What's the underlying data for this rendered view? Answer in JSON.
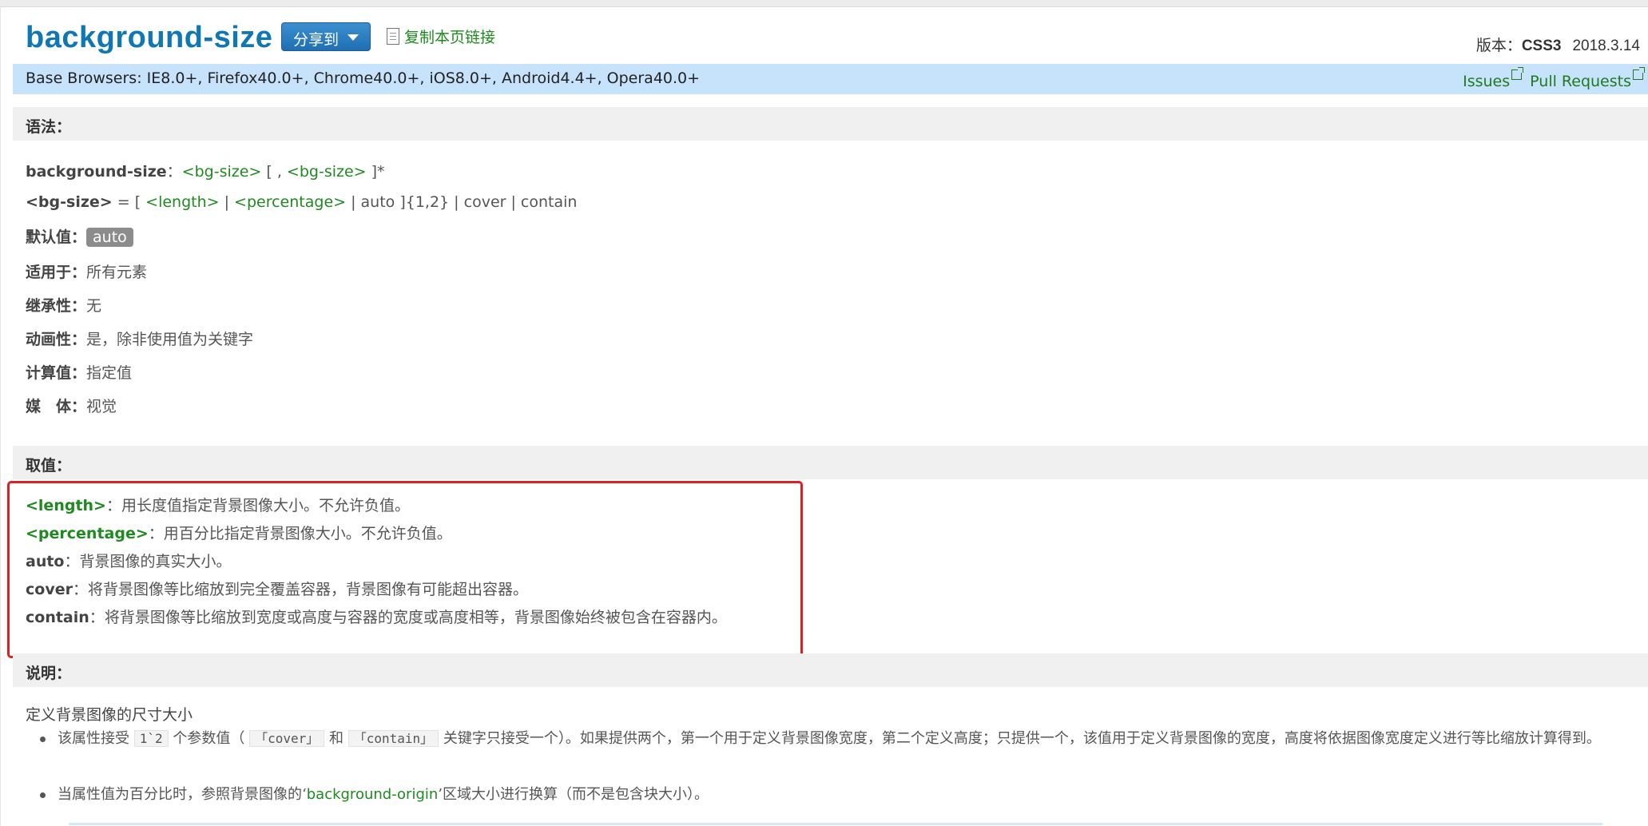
{
  "header": {
    "title": "background-size",
    "share_label": "分享到",
    "copy_link_label": "复制本页链接",
    "version_label": "版本：",
    "version_value": "CSS3",
    "date": "2018.3.14"
  },
  "browsers": {
    "text": "Base Browsers: IE8.0+, Firefox40.0+, Chrome40.0+, iOS8.0+, Android4.4+, Opera40.0+",
    "issues_label": "Issues",
    "pull_requests_label": "Pull Requests"
  },
  "syntax": {
    "heading": "语法：",
    "line1": {
      "prop": "background-size",
      "colon": "：",
      "t1": "<bg-size>",
      "mid": " [ , ",
      "t2": "<bg-size>",
      "end": " ]*"
    },
    "line2": {
      "name": "<bg-size>",
      "eq": " = [ ",
      "t1": "<length>",
      "sep1": " | ",
      "t2": "<percentage>",
      "rest": " | auto ]{1,2} | cover | contain"
    },
    "default_label": "默认值：",
    "default_value": "auto",
    "applies_label": "适用于：",
    "applies_value": "所有元素",
    "inherit_label": "继承性：",
    "inherit_value": "无",
    "anim_label": "动画性：",
    "anim_value": "是，除非使用值为关键字",
    "computed_label": "计算值：",
    "computed_value": "指定值",
    "media_label": "媒　体：",
    "media_value": "视觉"
  },
  "values": {
    "heading": "取值：",
    "items": [
      {
        "key": "<length>",
        "sep": "：",
        "desc": "用长度值指定背景图像大小。不允许负值。",
        "green": true
      },
      {
        "key": "<percentage>",
        "sep": "：",
        "desc": "用百分比指定背景图像大小。不允许负值。",
        "green": true
      },
      {
        "key": "auto",
        "sep": "：",
        "desc": "背景图像的真实大小。",
        "green": false
      },
      {
        "key": "cover",
        "sep": "：",
        "desc": "将背景图像等比缩放到完全覆盖容器，背景图像有可能超出容器。",
        "green": false
      },
      {
        "key": "contain",
        "sep": "：",
        "desc": "将背景图像等比缩放到宽度或高度与容器的宽度或高度相等，背景图像始终被包含在容器内。",
        "green": false
      }
    ]
  },
  "notes": {
    "heading": "说明：",
    "subtitle": "定义背景图像的尺寸大小",
    "bullet1": {
      "a": "该属性接受",
      "code1": "1`2",
      "b": "个参数值（",
      "code2": "「cover」",
      "c": "和",
      "code3": "「contain」",
      "d": "关键字只接受一个）。如果提供两个，第一个用于定义背景图像宽度，第二个定义高度；只提供一个，该值用于定义背景图像的宽度，高度将依据图像宽度定义进行等比缩放计算得到。"
    },
    "bullet2": {
      "a": "当属性值为百分比时，参照背景图像的‘",
      "link": "background-origin",
      "b": "’区域大小进行换算（而不是包含块大小）。"
    }
  }
}
